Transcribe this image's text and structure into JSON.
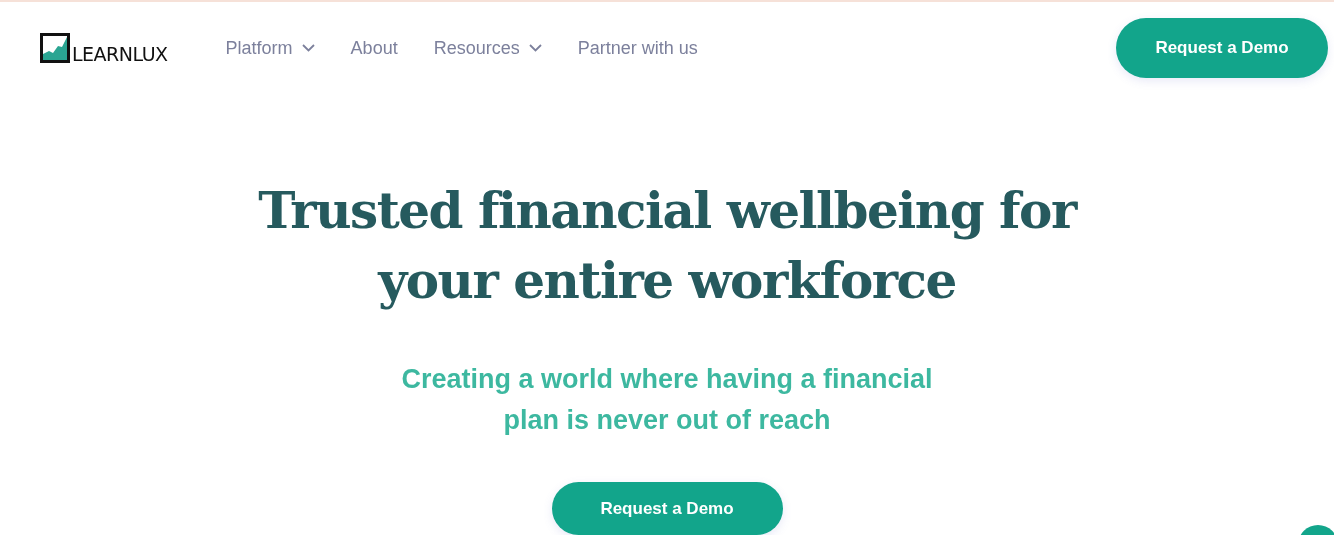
{
  "logo": {
    "text": "LEARNLUX"
  },
  "nav": [
    {
      "label": "Platform",
      "dropdown": true
    },
    {
      "label": "About",
      "dropdown": false
    },
    {
      "label": "Resources",
      "dropdown": true
    },
    {
      "label": "Partner with us",
      "dropdown": false
    }
  ],
  "header_button": "Request a Demo",
  "hero": {
    "title": "Trusted financial wellbeing for your entire workforce",
    "subtitle": "Creating a world where having a financial plan is never out of reach",
    "button": "Request a Demo"
  }
}
